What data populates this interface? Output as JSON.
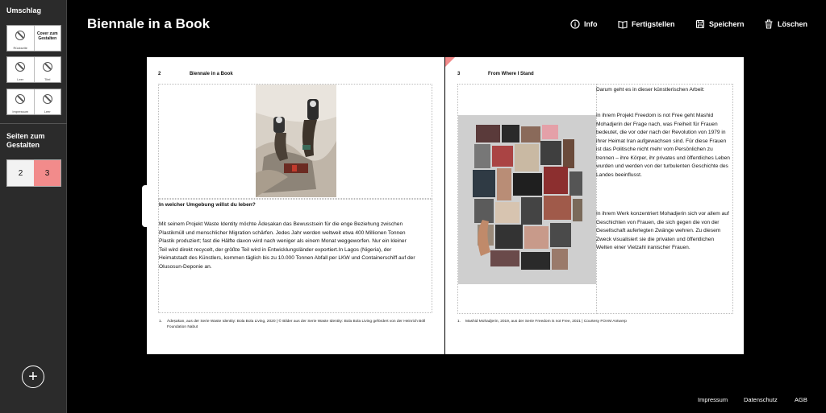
{
  "sidebar": {
    "cover_heading": "Umschlag",
    "cover_thumbs": [
      {
        "left": "Rückseite",
        "right_title": "Cover zum Gestalten"
      },
      {
        "left": "Leer",
        "right": "Titel"
      },
      {
        "left": "Impressum",
        "right": "Leer"
      }
    ],
    "pages_heading": "Seiten zum Gestalten",
    "pages": [
      "2",
      "3"
    ],
    "add_label": "+"
  },
  "header": {
    "title": "Biennale in a Book",
    "actions": [
      {
        "label": "Info",
        "icon": "info-icon"
      },
      {
        "label": "Fertigstellen",
        "icon": "book-icon"
      },
      {
        "label": "Speichern",
        "icon": "save-icon"
      },
      {
        "label": "Löschen",
        "icon": "trash-icon"
      }
    ]
  },
  "left_page": {
    "number": "2",
    "header": "Biennale in a Book",
    "question": "In welcher Umgebung willst du leben?",
    "body": "Mit seinem Projekt Waste Identity möchte Àdeṣakan das Bewusstsein für die enge Beziehung zwischen Plastikmüll und menschlicher Migration schärfen. Jedes Jahr werden weltweit etwa 400 Millionen Tonnen Plastik produziert; fast die Hälfte davon wird nach weniger als einem Monat weggeworfen. Nur ein kleiner Teil wird direkt recycelt, der größte Teil wird in Entwicklungsländer exportiert.In Lagos (Nigeria), der Heimatstadt des Künstlers, kommen täglich bis zu 10.000 Tonnen Abfall per LKW und Containerschiff auf der Olusosun-Deponie an.",
    "footnote_num": "1.",
    "footnote": "Àdeṣakan, aus der Serie Waste Identity: Bola Bola Living, 2020 | © Bilder aus der Serie Waste Identity: Bola Bola Living gefördert von der Heinrich Böll Foundation Nabut"
  },
  "right_page": {
    "number": "3",
    "header": "From Where I Stand",
    "intro": "Darum geht es in dieser künstlerischen Arbeit:",
    "para1": "In ihrem Projekt Freedom is not Free geht Mashid Mohadjerin der Frage nach, was Freiheit für Frauen bedeutet, die vor oder nach der Revolution von 1979 in ihrer Heimat Iran aufgewachsen sind. Für diese Frauen ist das Politische nicht mehr vom Persönlichen zu trennen – ihre Körper, ihr privates und öffentliches Leben wurden und werden von der turbulenten Geschichte des Landes beeinflusst.",
    "para2": "In ihrem Werk konzentriert Mohadjerin sich vor allem auf Geschichten von Frauen, die sich gegen die von der Gesellschaft auferlegten Zwänge wehren. Zu diesem Zweck visualisiert sie die privaten und öffentlichen Welten einer Vielzahl iranischer Frauen.",
    "footnote_num": "1.",
    "footnote": "Mashid Mohadjerin, 2019, aus der Serie Freedom is not Free, 2021 | Courtesy FOAM Antwerp"
  },
  "footer": {
    "links": [
      "Impressum",
      "Datenschutz",
      "AGB"
    ]
  },
  "colors": {
    "accent": "#f28b8b",
    "sidebar_bg": "#2b2b2b",
    "page_bg": "#000000"
  }
}
